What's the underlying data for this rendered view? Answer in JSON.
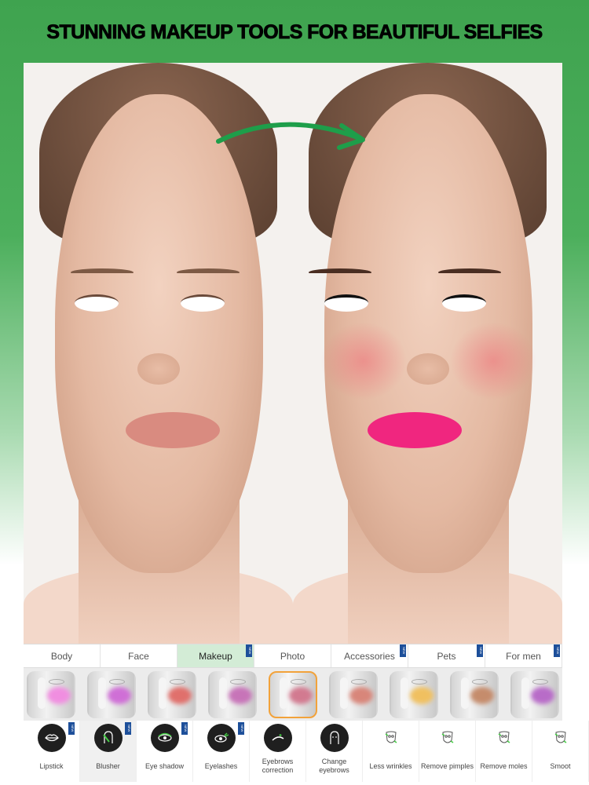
{
  "title": "STUNNING MAKEUP TOOLS FOR BEAUTIFUL SELFIES",
  "colors": {
    "banner_green": "#3fa34f",
    "active_tab": "#d3ecd6",
    "selected_thumb": "#f2a23a",
    "new_badge": "#1d4f9a",
    "lipstick_after": "#f0267f"
  },
  "photos": {
    "before": "original-face-photo",
    "after": "makeup-face-photo",
    "arrow": "curved-arrow-right"
  },
  "new_badge": "NEW",
  "tabs": [
    {
      "label": "Body",
      "new": false
    },
    {
      "label": "Face",
      "new": false
    },
    {
      "label": "Makeup",
      "new": true,
      "active": true
    },
    {
      "label": "Photo",
      "new": false
    },
    {
      "label": "Accessories",
      "new": true
    },
    {
      "label": "Pets",
      "new": true
    },
    {
      "label": "For men",
      "new": true
    }
  ],
  "blush_swatches": [
    "#f08ee0",
    "#cf6fd6",
    "#e0706c",
    "#c774b8",
    "#d27a90",
    "#d8867a",
    "#f0c060",
    "#c58c6c",
    "#b86cc8"
  ],
  "selected_swatch": 5,
  "tools": [
    {
      "label": "Lipstick",
      "icon": "lips-icon",
      "new": true
    },
    {
      "label": "Blusher",
      "icon": "blusher-icon",
      "new": true,
      "selected": true
    },
    {
      "label": "Eye shadow",
      "icon": "eye-shadow-icon",
      "new": true
    },
    {
      "label": "Eyelashes",
      "icon": "eyelashes-icon",
      "new": true
    },
    {
      "label": "Eyebrows correction",
      "icon": "eyebrow-icon",
      "new": false
    },
    {
      "label": "Change eyebrows",
      "icon": "face-eyebrows-icon",
      "new": false
    },
    {
      "label": "Less wrinkles",
      "icon": "mask-wrinkles-icon",
      "new": false
    },
    {
      "label": "Remove pimples",
      "icon": "mask-pimples-icon",
      "new": false
    },
    {
      "label": "Remove moles",
      "icon": "mask-moles-icon",
      "new": false
    },
    {
      "label": "Smoot",
      "icon": "mask-smooth-icon",
      "new": false
    }
  ]
}
